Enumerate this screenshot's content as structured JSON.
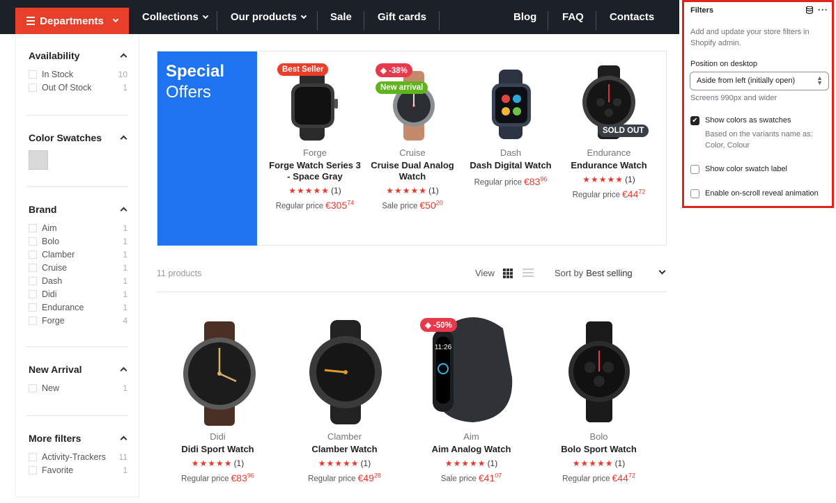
{
  "nav": {
    "departments": "Departments",
    "items": [
      "Collections",
      "Our products",
      "Sale",
      "Gift cards",
      "Blog",
      "FAQ",
      "Contacts"
    ]
  },
  "filters": {
    "availability": {
      "title": "Availability",
      "options": [
        {
          "label": "In Stock",
          "count": "10"
        },
        {
          "label": "Out Of Stock",
          "count": "1"
        }
      ]
    },
    "color": {
      "title": "Color Swatches"
    },
    "brand": {
      "title": "Brand",
      "options": [
        {
          "label": "Aim",
          "count": "1"
        },
        {
          "label": "Bolo",
          "count": "1"
        },
        {
          "label": "Clamber",
          "count": "1"
        },
        {
          "label": "Cruise",
          "count": "1"
        },
        {
          "label": "Dash",
          "count": "1"
        },
        {
          "label": "Didi",
          "count": "1"
        },
        {
          "label": "Endurance",
          "count": "1"
        },
        {
          "label": "Forge",
          "count": "4"
        }
      ]
    },
    "new_arrival": {
      "title": "New Arrival",
      "options": [
        {
          "label": "New",
          "count": "1"
        }
      ]
    },
    "more": {
      "title": "More filters",
      "options": [
        {
          "label": "Activity-Trackers",
          "count": "11"
        },
        {
          "label": "Favorite",
          "count": "1"
        }
      ]
    }
  },
  "offers": {
    "title1": "Special",
    "title2": "Offers",
    "cards": [
      {
        "badge": "Best Seller",
        "brand": "Forge",
        "name": "Forge Watch Series 3 - Space Gray",
        "stars": "★★★★★",
        "reviews": "(1)",
        "price_label": "Regular price",
        "price": "€305",
        "cents": "74"
      },
      {
        "badge": "-38%",
        "badge2": "New arrival",
        "brand": "Cruise",
        "name": "Cruise Dual Analog Watch",
        "stars": "★★★★★",
        "reviews": "(1)",
        "price_label": "Sale price",
        "price": "€50",
        "cents": "20"
      },
      {
        "brand": "Dash",
        "name": "Dash Digital Watch",
        "price_label": "Regular price",
        "price": "€83",
        "cents": "96"
      },
      {
        "badge": "SOLD OUT",
        "brand": "Endurance",
        "name": "Endurance Watch",
        "stars": "★★★★★",
        "reviews": "(1)",
        "price_label": "Regular price",
        "price": "€44",
        "cents": "72"
      }
    ]
  },
  "toolbar": {
    "count": "11 products",
    "view": "View",
    "sort_label": "Sort by",
    "sort_value": "Best selling"
  },
  "products": [
    {
      "brand": "Didi",
      "name": "Didi Sport Watch",
      "stars": "★★★★★",
      "reviews": "(1)",
      "price_label": "Regular price",
      "price": "€83",
      "cents": "96"
    },
    {
      "brand": "Clamber",
      "name": "Clamber Watch",
      "stars": "★★★★★",
      "reviews": "(1)",
      "price_label": "Regular price",
      "price": "€49",
      "cents": "28"
    },
    {
      "badge": "-50%",
      "brand": "Aim",
      "name": "Aim Analog Watch",
      "stars": "★★★★★",
      "reviews": "(1)",
      "price_label": "Sale price",
      "price": "€41",
      "cents": "07"
    },
    {
      "brand": "Bolo",
      "name": "Bolo Sport Watch",
      "stars": "★★★★★",
      "reviews": "(1)",
      "price_label": "Regular price",
      "price": "€44",
      "cents": "72"
    }
  ],
  "panel": {
    "title": "Filters",
    "desc": "Add and update your store filters in Shopify admin.",
    "position_label": "Position on desktop",
    "position_value": "Aside from left (initially open)",
    "position_help": "Screens 990px and wider",
    "swatches_label": "Show colors as swatches",
    "swatches_note": "Based on the variants name as: Color, Colour",
    "swatch_label": "Show color swatch label",
    "reveal_label": "Enable on-scroll reveal animation"
  },
  "colors": {
    "nav_bg": "#1c2129",
    "departments": "#e83f2b",
    "offers_blue": "#1e73f0",
    "price_red": "#e8392d",
    "panel_border": "#e2231a"
  }
}
